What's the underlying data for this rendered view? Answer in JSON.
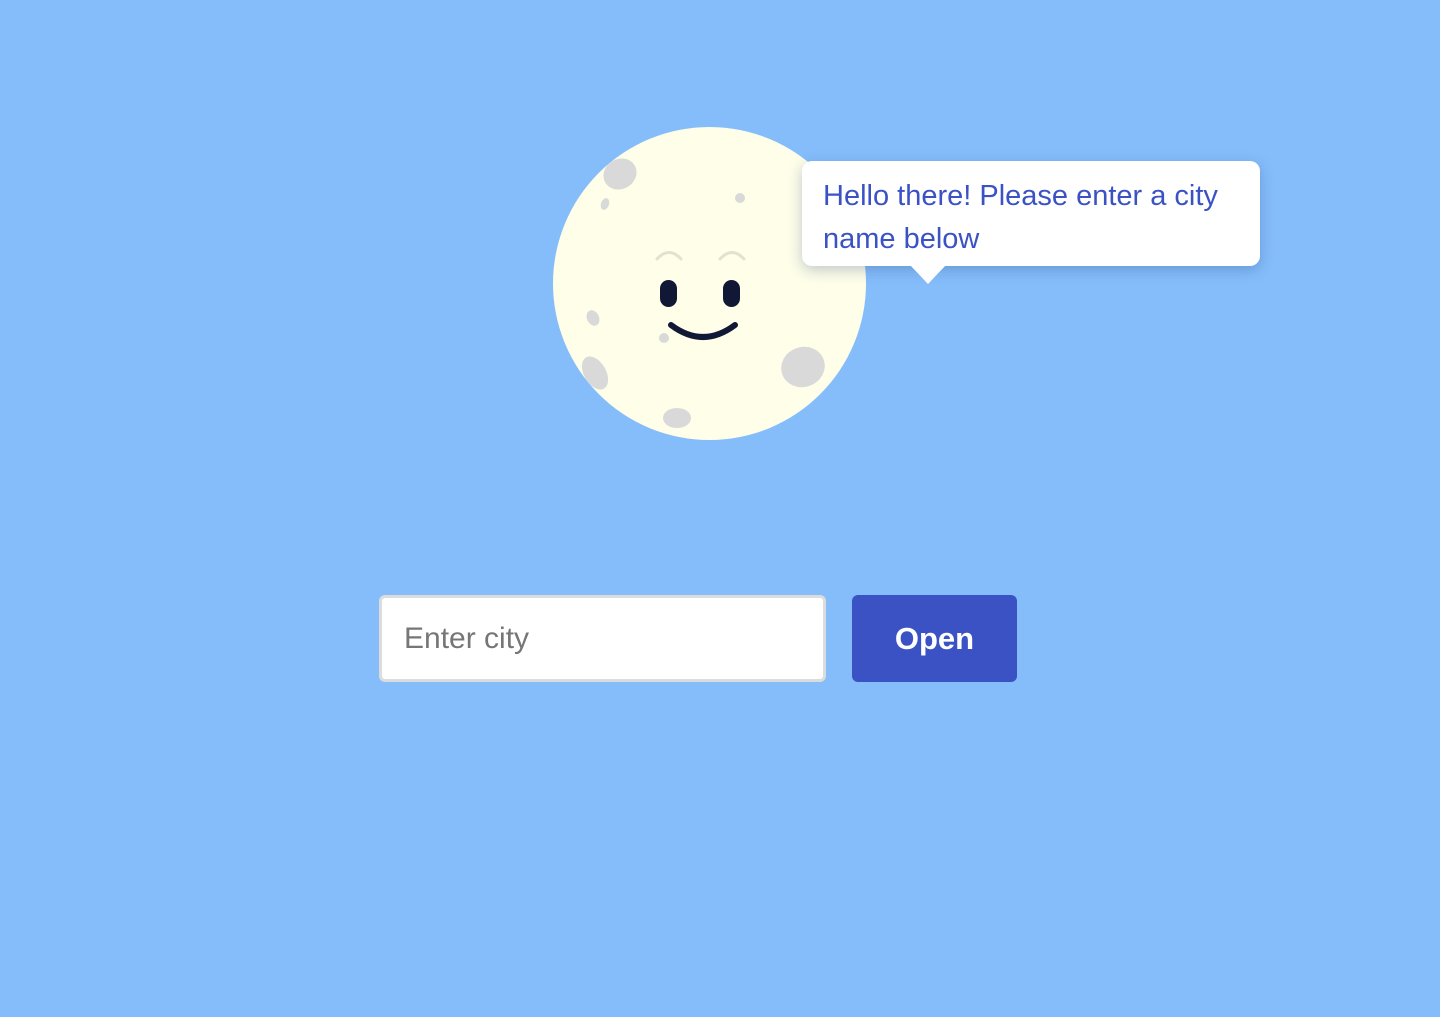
{
  "mascot": {
    "icon": "smiling-moon-icon",
    "speech": "Hello there! Please enter a city name below"
  },
  "search": {
    "placeholder": "Enter city",
    "value": ""
  },
  "actions": {
    "open_label": "Open"
  },
  "colors": {
    "background": "#85bdfb",
    "accent": "#3a52c4",
    "moon": "#fefee9",
    "crater": "#d9d9d9"
  }
}
